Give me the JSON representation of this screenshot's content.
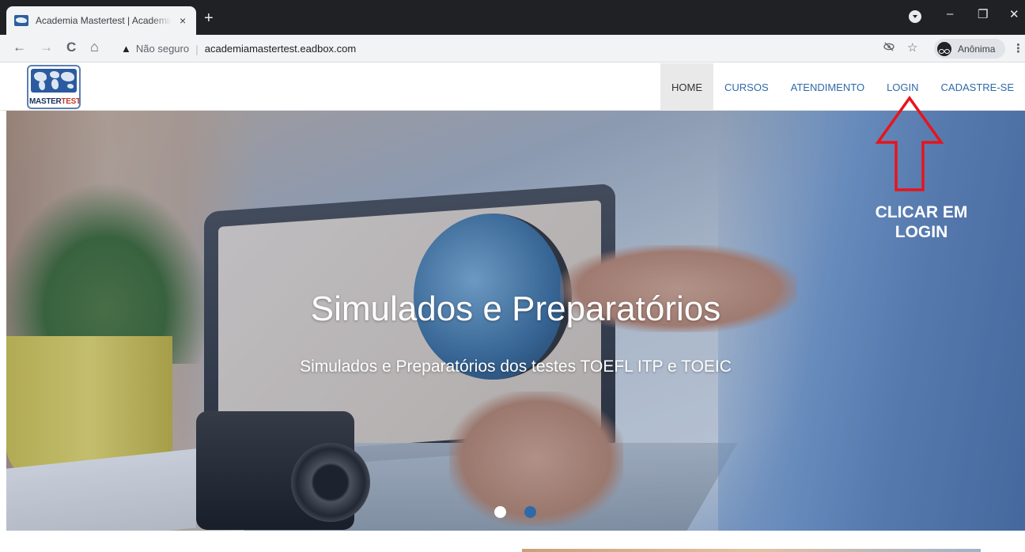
{
  "browser": {
    "tab_title": "Academia Mastertest | Academia",
    "tab_close": "×",
    "new_tab": "+",
    "window_controls": {
      "minimize": "–",
      "restore": "❐",
      "close": "✕"
    },
    "back": "←",
    "forward": "→",
    "reload": "C",
    "home": "⌂",
    "security_icon": "▲",
    "security_label": "Não seguro",
    "separator": "|",
    "url": "academiamastertest.eadbox.com",
    "star": "☆",
    "eye_off": "👁",
    "profile_label": "Anônima",
    "menu": "⋮"
  },
  "site": {
    "logo": {
      "text_main": "MASTER",
      "text_accent": "TEST"
    },
    "nav": [
      {
        "label": "HOME",
        "active": true
      },
      {
        "label": "CURSOS",
        "active": false
      },
      {
        "label": "ATENDIMENTO",
        "active": false
      },
      {
        "label": "LOGIN",
        "active": false
      },
      {
        "label": "CADASTRE-SE",
        "active": false
      }
    ]
  },
  "hero": {
    "title": "Simulados e Preparatórios",
    "subtitle": "Simulados e Preparatórios dos testes TOEFL ITP e TOEIC",
    "slides": 2,
    "active_slide": 1
  },
  "annotation": {
    "line1": "CLICAR EM",
    "line2": "LOGIN",
    "arrow_color": "#e8141b"
  }
}
